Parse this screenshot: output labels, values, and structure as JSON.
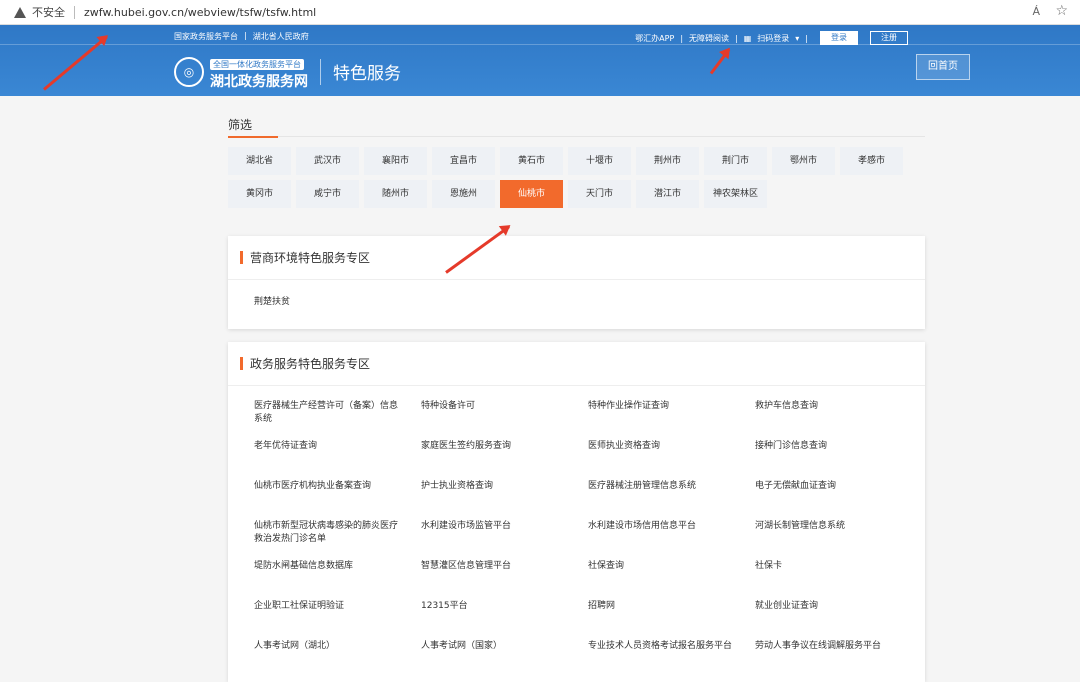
{
  "browser": {
    "security_label": "不安全",
    "url": "zwfw.hubei.gov.cn/webview/tsfw/tsfw.html",
    "read_aloud": "Á",
    "favorite": "☆"
  },
  "header": {
    "top_left": [
      "国家政务服务平台",
      "|",
      "湖北省人民政府"
    ],
    "top_right": {
      "app": "鄂汇办APP",
      "accessible": "无障碍阅读",
      "qr_login": "扫码登录",
      "login": "登录",
      "register": "注册"
    },
    "logo_small": "全国一体化政务服务平台",
    "logo_big": "湖北政务服务网",
    "section": "特色服务",
    "home_button": "回首页"
  },
  "filter": {
    "title": "筛选",
    "cities": [
      "湖北省",
      "武汉市",
      "襄阳市",
      "宜昌市",
      "黄石市",
      "十堰市",
      "荆州市",
      "荆门市",
      "鄂州市",
      "孝感市",
      "黄冈市",
      "咸宁市",
      "随州市",
      "恩施州",
      "仙桃市",
      "天门市",
      "潜江市",
      "神农架林区"
    ],
    "active_index": 14
  },
  "panel1": {
    "title": "营商环境特色服务专区",
    "items": [
      "荆楚扶贫"
    ]
  },
  "panel2": {
    "title": "政务服务特色服务专区",
    "items": [
      "医疗器械生产经营许可（备案）信息系统",
      "特种设备许可",
      "特种作业操作证查询",
      "救护车信息查询",
      "老年优待证查询",
      "家庭医生签约服务查询",
      "医师执业资格查询",
      "接种门诊信息查询",
      "仙桃市医疗机构执业备案查询",
      "护士执业资格查询",
      "医疗器械注册管理信息系统",
      "电子无偿献血证查询",
      "仙桃市新型冠状病毒感染的肺炎医疗救治发热门诊名单",
      "水利建设市场监管平台",
      "水利建设市场信用信息平台",
      "河湖长制管理信息系统",
      "堤防水闸基础信息数据库",
      "智慧灌区信息管理平台",
      "社保查询",
      "社保卡",
      "企业职工社保证明验证",
      "12315平台",
      "招聘网",
      "就业创业证查询",
      "人事考试网（湖北）",
      "人事考试网（国家）",
      "专业技术人员资格考试报名服务平台",
      "劳动人事争议在线调解服务平台"
    ]
  },
  "colors": {
    "accent": "#f26a2c",
    "header_blue": "#2f78c6",
    "arrow_red": "#e53a2a"
  }
}
